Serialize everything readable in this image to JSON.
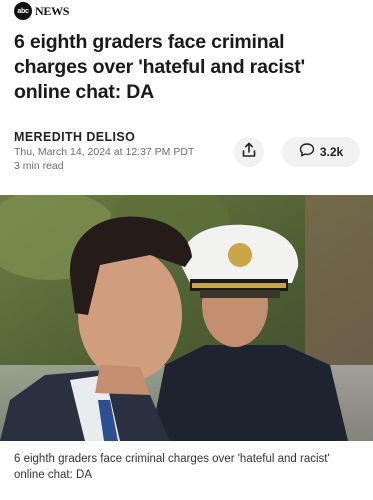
{
  "brand": {
    "logo_mark": "abc",
    "logo_text": "NEWS"
  },
  "article": {
    "headline": "6 eighth graders face criminal charges over 'hateful and racist' online chat: DA",
    "author": "MEREDITH DELISO",
    "date": "Thu, March 14, 2024 at 12:37 PM PDT",
    "read_time": "3 min read"
  },
  "actions": {
    "share_icon": "share-icon",
    "comment_icon": "comment-bubble-icon",
    "comment_count": "3.2k"
  },
  "photo": {
    "caption": "6 eighth graders face criminal charges over 'hateful and racist' online chat: DA"
  }
}
